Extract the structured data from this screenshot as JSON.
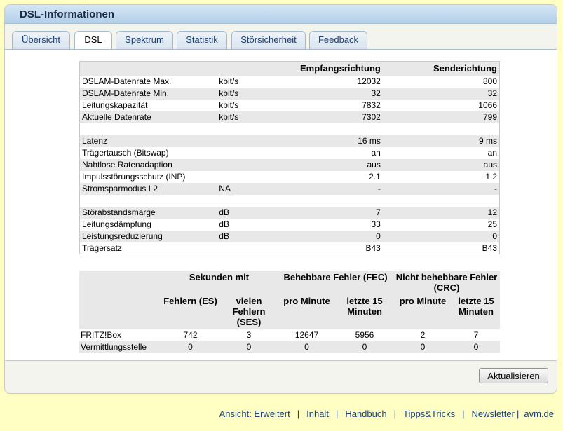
{
  "header": {
    "title": "DSL-Informationen"
  },
  "tabs": [
    "Übersicht",
    "DSL",
    "Spektrum",
    "Statistik",
    "Störsicherheit",
    "Feedback"
  ],
  "table1": {
    "col_receive": "Empfangsrichtung",
    "col_send": "Senderichtung",
    "rows": [
      {
        "label": "DSLAM-Datenrate Max.",
        "unit": "kbit/s",
        "rx": "12032",
        "tx": "800"
      },
      {
        "label": "DSLAM-Datenrate Min.",
        "unit": "kbit/s",
        "rx": "32",
        "tx": "32"
      },
      {
        "label": "Leitungskapazität",
        "unit": "kbit/s",
        "rx": "7832",
        "tx": "1066"
      },
      {
        "label": "Aktuelle Datenrate",
        "unit": "kbit/s",
        "rx": "7302",
        "tx": "799"
      },
      {
        "label": "Latenz",
        "unit": "",
        "rx": "16 ms",
        "tx": "9 ms"
      },
      {
        "label": "Trägertausch (Bitswap)",
        "unit": "",
        "rx": "an",
        "tx": "an"
      },
      {
        "label": "Nahtlose Ratenadaption",
        "unit": "",
        "rx": "aus",
        "tx": "aus"
      },
      {
        "label": "Impulsstörungsschutz (INP)",
        "unit": "",
        "rx": "2.1",
        "tx": "1.2"
      },
      {
        "label": "Stromsparmodus L2",
        "unit": "NA",
        "rx": "-",
        "tx": "-"
      },
      {
        "label": "Störabstandsmarge",
        "unit": "dB",
        "rx": "7",
        "tx": "12"
      },
      {
        "label": "Leitungsdämpfung",
        "unit": "dB",
        "rx": "33",
        "tx": "25"
      },
      {
        "label": "Leistungsreduzierung",
        "unit": "dB",
        "rx": "0",
        "tx": "0"
      },
      {
        "label": "Trägersatz",
        "unit": "",
        "rx": "B43",
        "tx": "B43"
      }
    ]
  },
  "table2": {
    "group1": "Sekunden mit",
    "group2": "Behebbare Fehler (FEC)",
    "group3": "Nicht behebbare Fehler (CRC)",
    "sub": [
      "Fehlern (ES)",
      "vielen Fehlern (SES)",
      "pro Minute",
      "letzte 15 Minuten",
      "pro Minute",
      "letzte 15 Minuten"
    ],
    "rows": [
      {
        "label": "FRITZ!Box",
        "values": [
          "742",
          "3",
          "12647",
          "5956",
          "2",
          "7"
        ]
      },
      {
        "label": "Vermittlungsstelle",
        "values": [
          "0",
          "0",
          "0",
          "0",
          "0",
          "0"
        ]
      }
    ]
  },
  "refresh_label": "Aktualisieren",
  "footer": {
    "links": [
      "Ansicht: Erweitert",
      "Inhalt",
      "Handbuch",
      "Tipps&Tricks",
      "Newsletter",
      "avm.de"
    ]
  }
}
